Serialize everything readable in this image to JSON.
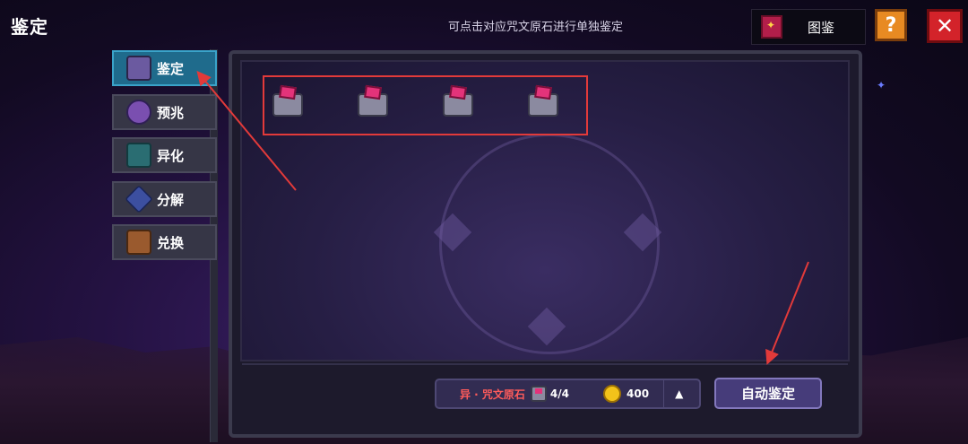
{
  "header": {
    "title": "鉴定",
    "hint": "可点击对应咒文原石进行单独鉴定",
    "codex_label": "图鉴",
    "help_label": "?",
    "close_label": "✕"
  },
  "sidebar": {
    "items": [
      {
        "label": "鉴定",
        "icon": "appraiser-icon",
        "active": true
      },
      {
        "label": "预兆",
        "icon": "crystal-ball-icon",
        "active": false
      },
      {
        "label": "异化",
        "icon": "mutation-icon",
        "active": false
      },
      {
        "label": "分解",
        "icon": "decompose-icon",
        "active": false
      },
      {
        "label": "兑换",
        "icon": "chest-icon",
        "active": false
      }
    ]
  },
  "stones": {
    "items": [
      {
        "icon": "rune-stone-icon"
      },
      {
        "icon": "rune-stone-icon"
      },
      {
        "icon": "rune-stone-icon"
      },
      {
        "icon": "rune-stone-icon"
      }
    ]
  },
  "footer": {
    "stone_name": "异 · 咒文原石",
    "stone_count": "4/4",
    "cost": "400",
    "auto_button": "自动鉴定"
  },
  "colors": {
    "active_tab": "#1f6b8c",
    "annotation": "#e23a3a",
    "stone_name": "#ff5b5b",
    "coin": "#f2c31a"
  }
}
